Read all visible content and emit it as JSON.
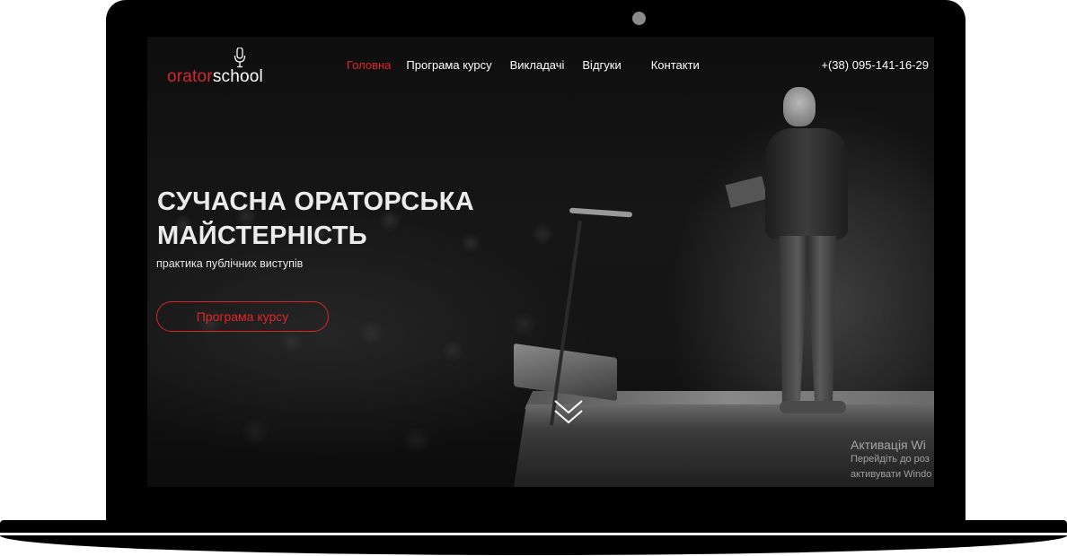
{
  "brand": {
    "logo_part1": "orator",
    "logo_part2": "school",
    "accent_color": "#e0262b"
  },
  "nav": {
    "items": [
      {
        "label": "Головна",
        "active": true
      },
      {
        "label": "Програма курсу",
        "active": false
      },
      {
        "label": "Викладачі",
        "active": false
      },
      {
        "label": "Відгуки",
        "active": false
      },
      {
        "label": "Контакти",
        "active": false
      }
    ]
  },
  "phone": "+(38) 095-141-16-29",
  "hero": {
    "title_line1": "СУЧАСНА ОРАТОРСЬКА",
    "title_line2": "МАЙСТЕРНІСТЬ",
    "subtitle": "практика публічних виступів",
    "cta_label": "Програма курсу"
  },
  "icons": {
    "logo": "microphone-icon",
    "scroll": "double-chevron-down-icon"
  },
  "watermark": {
    "title": "Активація Wi",
    "line1": "Перейдіть до роз",
    "line2": "активувати Windo"
  }
}
